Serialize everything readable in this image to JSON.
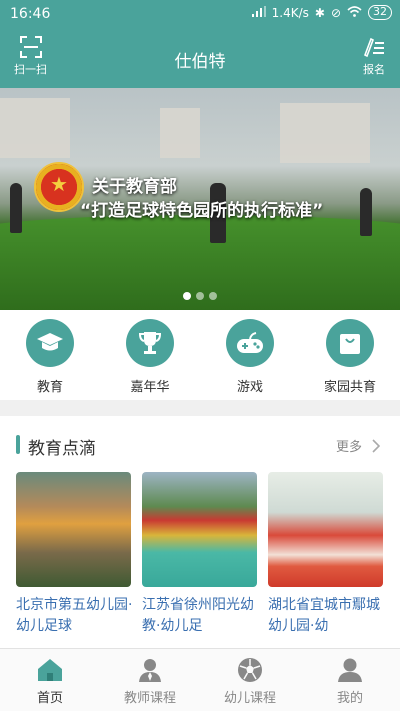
{
  "status_bar": {
    "time": "16:46",
    "network_speed": "1.4K/s",
    "battery": "32"
  },
  "header": {
    "title": "仕伯特",
    "scan_label": "扫一扫",
    "register_label": "报名"
  },
  "banner": {
    "line1": "关于教育部",
    "line2": "“打造足球特色园所的执行标准”",
    "slide_count": 3,
    "active_slide": 1
  },
  "quick_nav": [
    {
      "label": "教育",
      "icon": "graduation-cap-icon"
    },
    {
      "label": "嘉年华",
      "icon": "trophy-icon"
    },
    {
      "label": "游戏",
      "icon": "gamepad-icon"
    },
    {
      "label": "家园共育",
      "icon": "shopping-bag-icon"
    }
  ],
  "section": {
    "title": "教育点滴",
    "more_label": "更多"
  },
  "cards": [
    {
      "caption": "北京市第五幼儿园·幼儿足球"
    },
    {
      "caption": "江苏省徐州阳光幼教·幼儿足"
    },
    {
      "caption": "湖北省宜城市鄢城幼儿园·幼"
    }
  ],
  "tabbar": [
    {
      "label": "首页",
      "icon": "home-icon",
      "active": true
    },
    {
      "label": "教师课程",
      "icon": "teacher-icon",
      "active": false
    },
    {
      "label": "幼儿课程",
      "icon": "football-icon",
      "active": false
    },
    {
      "label": "我的",
      "icon": "user-icon",
      "active": false
    }
  ],
  "colors": {
    "primary": "#4aa39b",
    "link": "#3a6fb0"
  }
}
